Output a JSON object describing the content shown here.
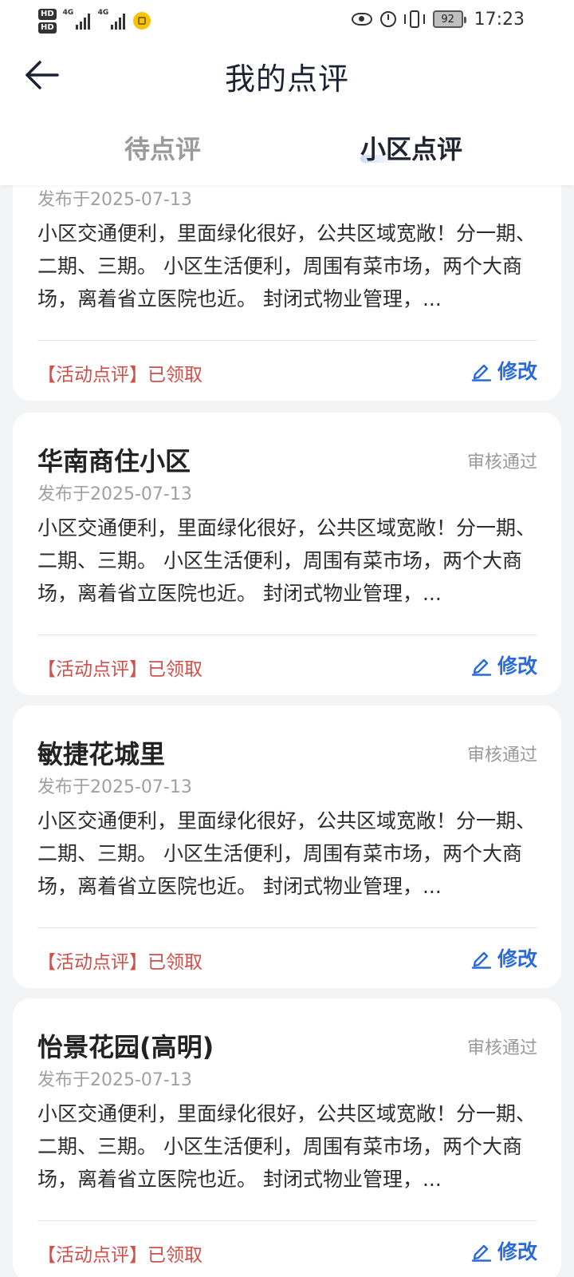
{
  "status_bar": {
    "hd1": "HD",
    "hd2": "HD",
    "net1": "4G",
    "net2": "4G",
    "battery": "92",
    "time": "17:23"
  },
  "header": {
    "title": "我的点评"
  },
  "tabs": [
    {
      "label": "待点评",
      "active": false
    },
    {
      "label": "小区点评",
      "active": true
    }
  ],
  "reviews": [
    {
      "name": "",
      "status": "",
      "date": "发布于2025-07-13",
      "content": "小区交通便利，里面绿化很好，公共区域宽敞！分一期、二期、三期。 小区生活便利，周围有菜市场，两个大商场，离着省立医院也近。 封闭式物业管理，...",
      "tag": "【活动点评】已领取",
      "edit_label": "修改"
    },
    {
      "name": "华南商住小区",
      "status": "审核通过",
      "date": "发布于2025-07-13",
      "content": "小区交通便利，里面绿化很好，公共区域宽敞！分一期、二期、三期。 小区生活便利，周围有菜市场，两个大商场，离着省立医院也近。 封闭式物业管理，...",
      "tag": "【活动点评】已领取",
      "edit_label": "修改"
    },
    {
      "name": "敏捷花城里",
      "status": "审核通过",
      "date": "发布于2025-07-13",
      "content": "小区交通便利，里面绿化很好，公共区域宽敞！分一期、二期、三期。 小区生活便利，周围有菜市场，两个大商场，离着省立医院也近。 封闭式物业管理，...",
      "tag": "【活动点评】已领取",
      "edit_label": "修改"
    },
    {
      "name": "怡景花园(高明)",
      "status": "审核通过",
      "date": "发布于2025-07-13",
      "content": "小区交通便利，里面绿化很好，公共区域宽敞！分一期、二期、三期。 小区生活便利，周围有菜市场，两个大商场，离着省立医院也近。 封闭式物业管理，...",
      "tag": "【活动点评】已领取",
      "edit_label": "修改"
    }
  ],
  "colors": {
    "accent_blue": "#2a6ad8",
    "tag_red": "#d0504a",
    "background": "#f3f4f6"
  }
}
